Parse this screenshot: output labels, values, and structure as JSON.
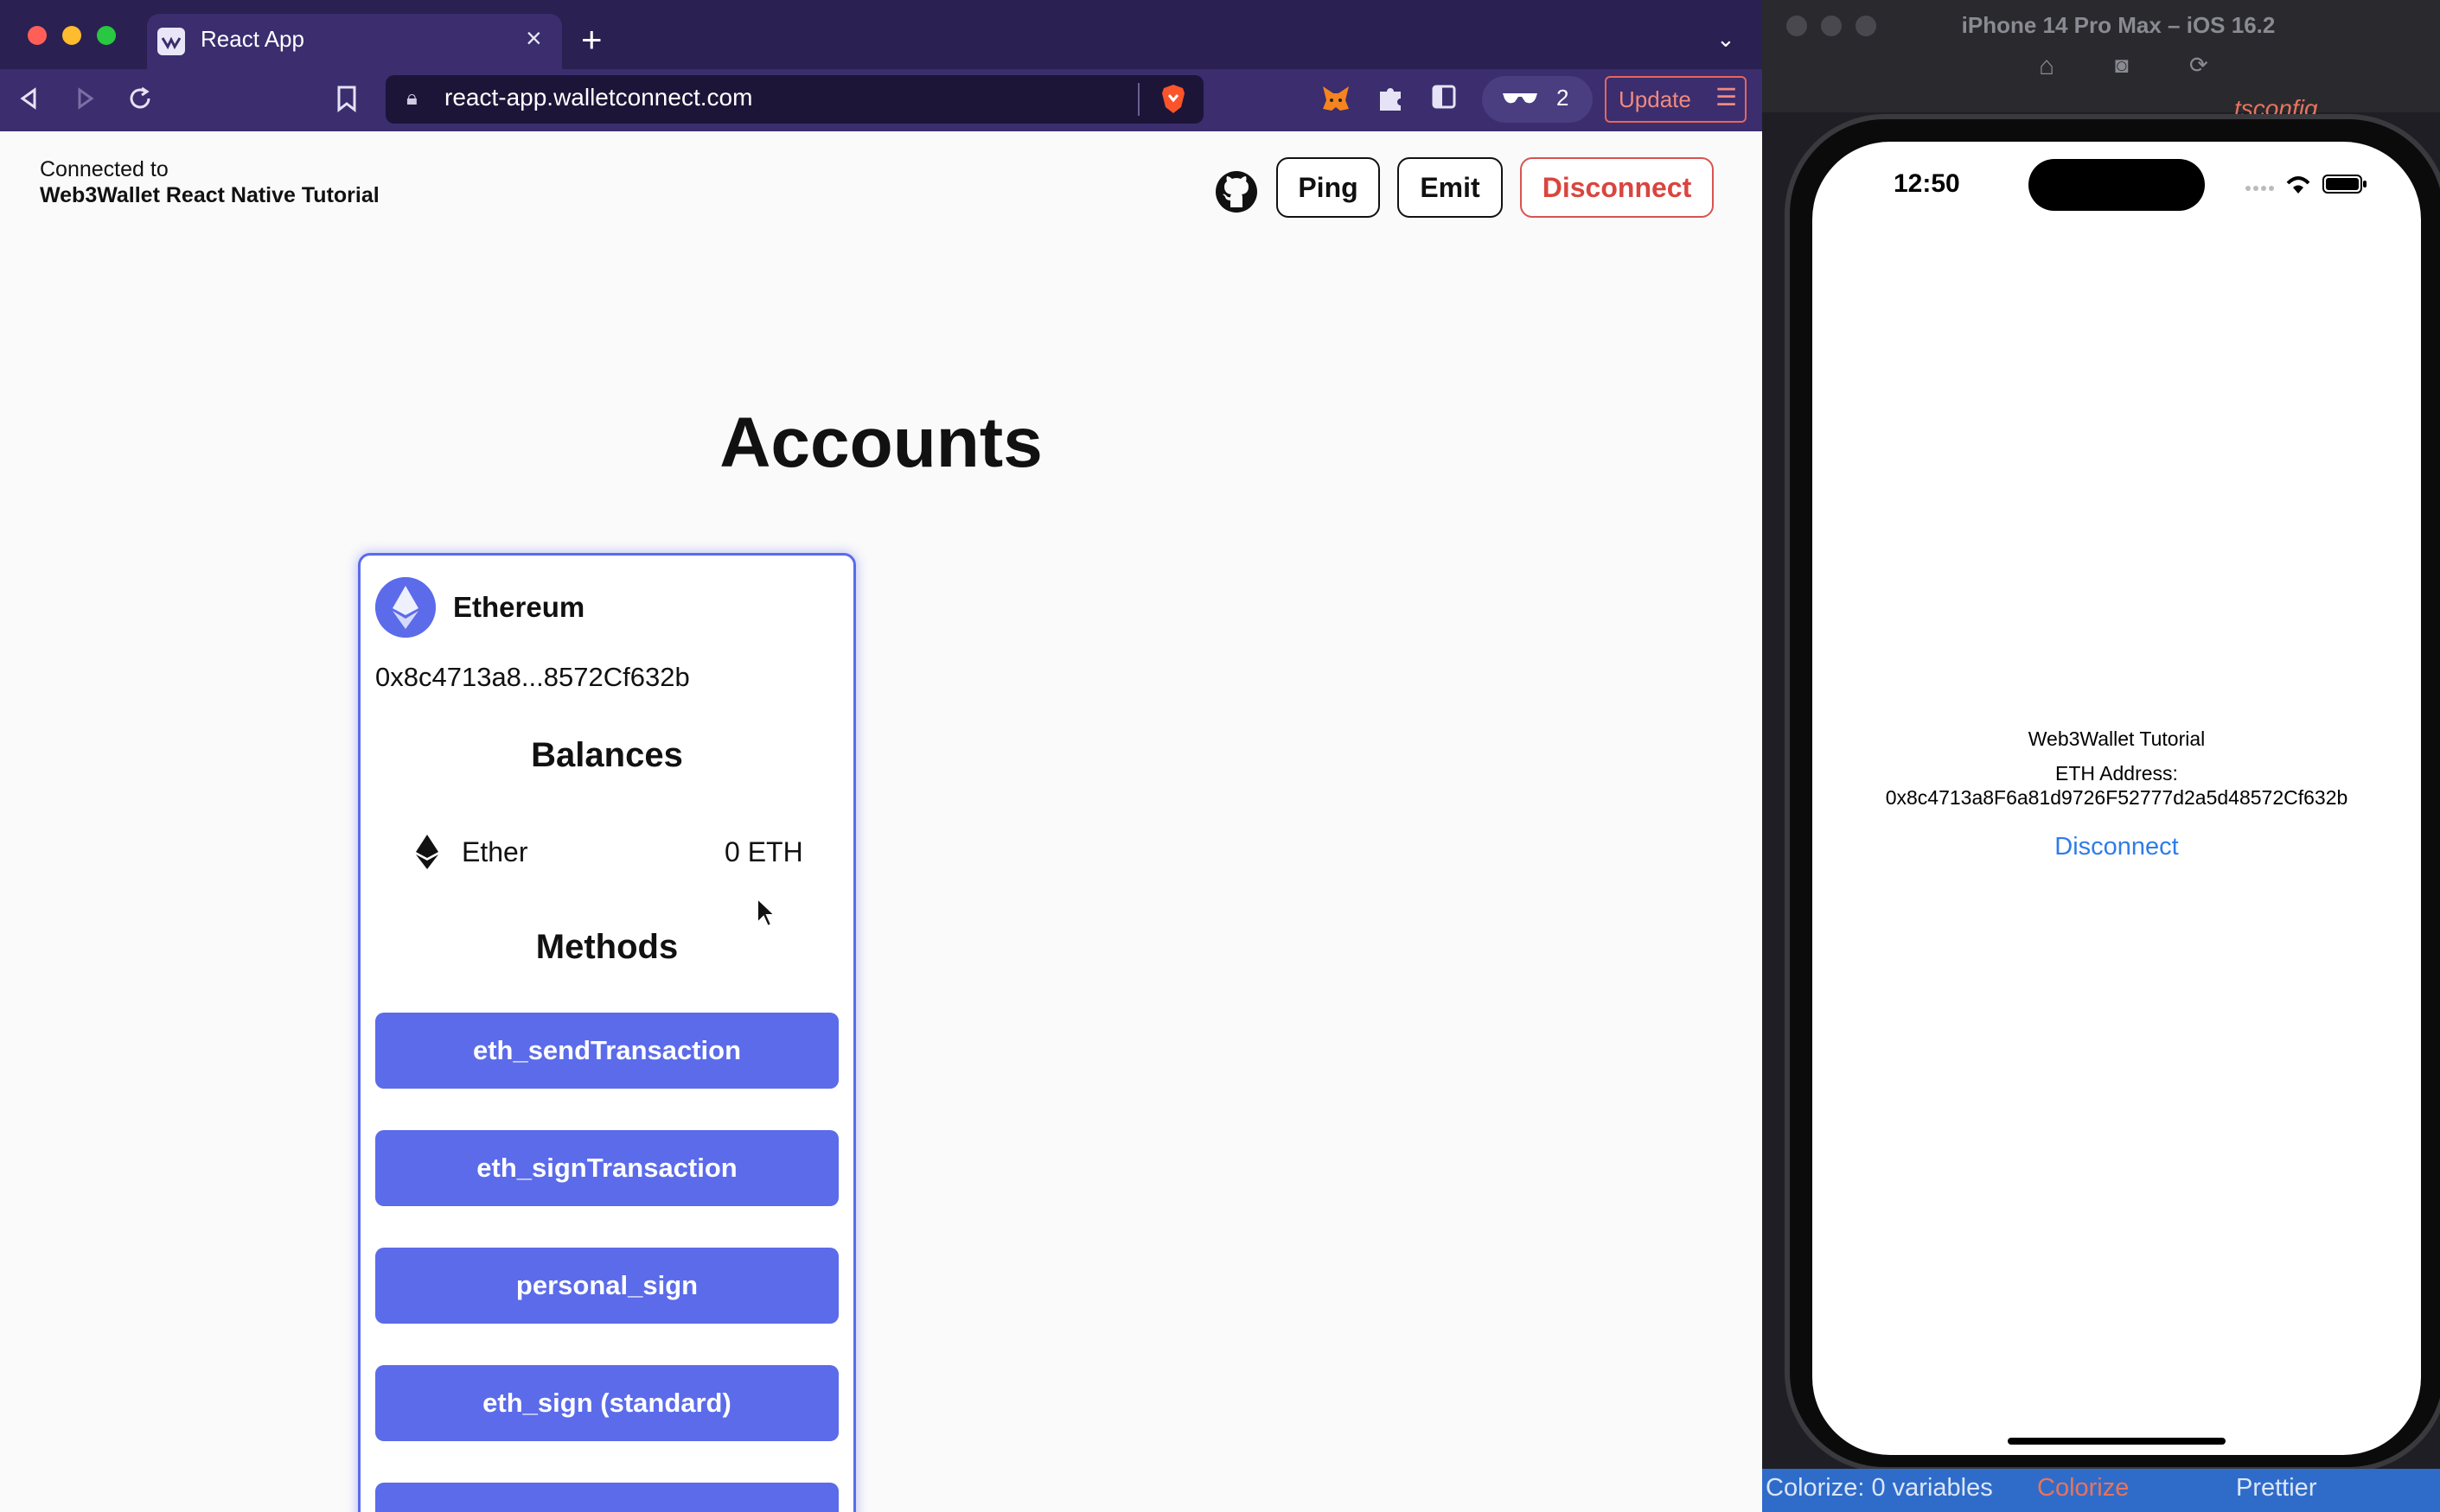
{
  "browser": {
    "tab_title": "React App",
    "url": "react-app.walletconnect.com",
    "extension_count": "2",
    "update_label": "Update"
  },
  "header": {
    "connected_label": "Connected to",
    "connected_name": "Web3Wallet React Native Tutorial",
    "buttons": {
      "ping": "Ping",
      "emit": "Emit",
      "disconnect": "Disconnect"
    }
  },
  "main": {
    "title": "Accounts",
    "account": {
      "chain": "Ethereum",
      "address": "0x8c4713a8...8572Cf632b",
      "balances_title": "Balances",
      "balances": [
        {
          "token": "Ether",
          "amount": "0 ETH"
        }
      ],
      "methods_title": "Methods",
      "methods": [
        "eth_sendTransaction",
        "eth_signTransaction",
        "personal_sign",
        "eth_sign (standard)"
      ]
    }
  },
  "simulator": {
    "title": "iPhone 14 Pro Max – iOS 16.2",
    "editor_tab": "tsconfig..",
    "status_time": "12:50",
    "app_title": "Web3Wallet Tutorial",
    "address_label": "ETH Address:",
    "address": "0x8c4713a8F6a81d9726F52777d2a5d48572Cf632b",
    "disconnect": "Disconnect"
  },
  "statusbar": {
    "colorize_vars": "Colorize: 0 variables",
    "colorize": "Colorize",
    "prettier": "Prettier"
  },
  "colors": {
    "accent": "#5b6bea",
    "danger": "#d9453f",
    "browser_chrome": "#3b2d6e"
  }
}
